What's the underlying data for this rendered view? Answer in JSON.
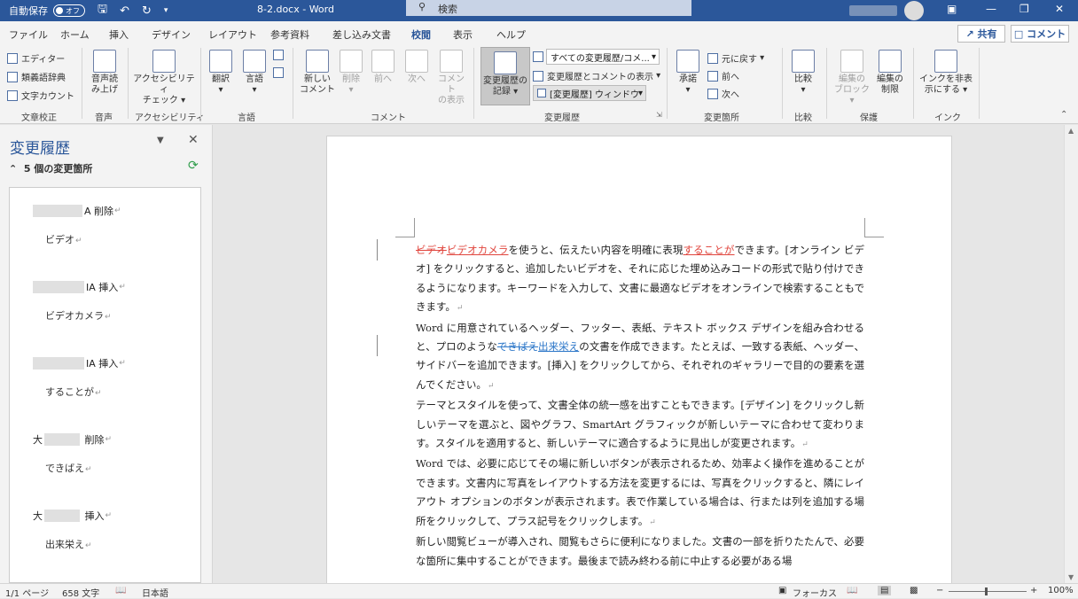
{
  "titlebar": {
    "autosave_label": "自動保存",
    "autosave_state": "オフ",
    "doc_title": "8-2.docx  -  Word",
    "search_placeholder": "検索"
  },
  "tabs": [
    "ファイル",
    "ホーム",
    "挿入",
    "デザイン",
    "レイアウト",
    "参考資料",
    "差し込み文書",
    "校閲",
    "表示",
    "ヘルプ"
  ],
  "active_tab": "校閲",
  "share_label": "共有",
  "comment_label": "コメント",
  "ribbon": {
    "proofing": {
      "editor": "エディター",
      "thesaurus": "類義語辞典",
      "wordcount": "文字カウント",
      "label": "文章校正"
    },
    "speech": {
      "read_aloud_1": "音声読",
      "read_aloud_2": "み上げ",
      "label": "音声"
    },
    "accessibility": {
      "check_1": "アクセシビリティ",
      "check_2": "チェック",
      "label": "アクセシビリティ"
    },
    "language": {
      "translate": "翻訳",
      "language": "言語",
      "label": "言語"
    },
    "comments": {
      "new_1": "新しい",
      "new_2": "コメント",
      "delete": "削除",
      "prev": "前へ",
      "next": "次へ",
      "show_1": "コメント",
      "show_2": "の表示",
      "label": "コメント"
    },
    "tracking": {
      "track_1": "変更履歴の",
      "track_2": "記録",
      "markup_dd": "すべての変更履歴/コメ...",
      "show_markup": "変更履歴とコメントの表示",
      "pane_dd": "[変更履歴] ウィンドウ",
      "label": "変更履歴"
    },
    "changes": {
      "accept": "承諾",
      "reject": "元に戻す",
      "prev": "前へ",
      "next": "次へ",
      "label": "変更箇所"
    },
    "compare": {
      "compare": "比較",
      "label": "比較"
    },
    "protect": {
      "block_1": "編集の",
      "block_2": "ブロック",
      "restrict_1": "編集の",
      "restrict_2": "制限",
      "label": "保護"
    },
    "ink": {
      "hide_1": "インクを非表",
      "hide_2": "示にする",
      "label": "インク"
    }
  },
  "pane": {
    "title": "変更履歴",
    "summary": "5 個の変更箇所",
    "revisions": [
      {
        "author_suffix": "A",
        "action": "削除",
        "text": "ビデオ"
      },
      {
        "author_suffix": "IA",
        "action": "挿入",
        "text": "ビデオカメラ"
      },
      {
        "author_suffix": "IA",
        "action": "挿入",
        "text": "することが"
      },
      {
        "author_prefix": "大",
        "action": "削除",
        "text": "できばえ"
      },
      {
        "author_prefix": "大",
        "action": "挿入",
        "text": "出来栄え"
      }
    ]
  },
  "document": {
    "p1_del": "ビデオ",
    "p1_ins": "ビデオカメラ",
    "p1_a": "を使うと、伝えたい内容を明確に表現",
    "p1_ins2": "することが",
    "p1_b": "できます。[オンライン ビデオ] をクリックすると、追加したいビデオを、それに応じた埋め込みコードの形式で貼り付けできるようになります。キーワードを入力して、文書に最適なビデオをオンラインで検索することもできます。",
    "p2_a": "Word に用意されているヘッダー、フッター、表紙、テキスト ボックス デザインを組み合わせると、プロのような",
    "p2_del": "できばえ",
    "p2_ins": "出来栄え",
    "p2_b": "の文書を作成できます。たとえば、一致する表紙、ヘッダー、サイドバーを追加できます。[挿入] をクリックしてから、それぞれのギャラリーで目的の要素を選んでください。",
    "p3": "テーマとスタイルを使って、文書全体の統一感を出すこともできます。[デザイン] をクリックし新しいテーマを選ぶと、図やグラフ、SmartArt グラフィックが新しいテーマに合わせて変わります。スタイルを適用すると、新しいテーマに適合するように見出しが変更されます。",
    "p4": "Word では、必要に応じてその場に新しいボタンが表示されるため、効率よく操作を進めることができます。文書内に写真をレイアウトする方法を変更するには、写真をクリックすると、隣にレイアウト オプションのボタンが表示されます。表で作業している場合は、行または列を追加する場所をクリックして、プラス記号をクリックします。",
    "p5": "新しい閲覧ビューが導入され、閲覧もさらに便利になりました。文書の一部を折りたたんで、必要な箇所に集中することができます。最後まで読み終わる前に中止する必要がある場"
  },
  "status": {
    "page": "1/1 ページ",
    "words": "658 文字",
    "lang": "日本語",
    "focus": "フォーカス",
    "zoom": "100%"
  },
  "colors": {
    "brand": "#2b579a",
    "delete_insert_a": "#e0453d",
    "delete_insert_b": "#2b76c8"
  }
}
